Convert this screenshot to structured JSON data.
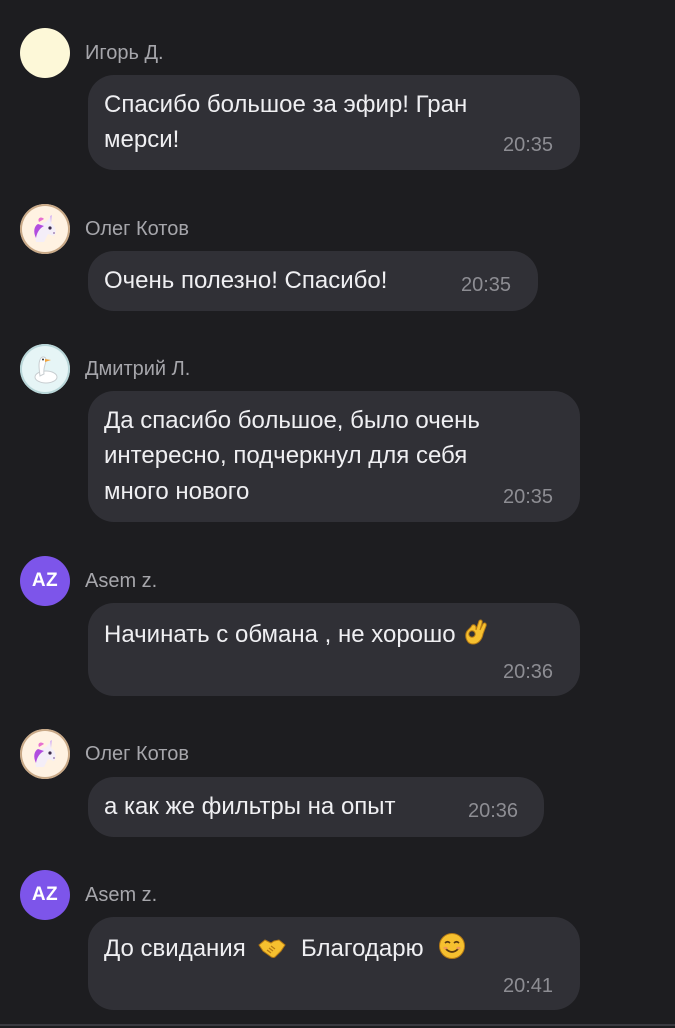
{
  "messages": [
    {
      "author": "Игорь Д.",
      "avatar": "blank-yellow-avatar",
      "lines": [
        "Спасибо большое за эфир! Гран",
        "мерси!"
      ],
      "time": "20:35"
    },
    {
      "author": "Олег Котов",
      "avatar": "unicorn-icon",
      "lines": [
        "Очень полезно! Спасибо!"
      ],
      "time": "20:35"
    },
    {
      "author": "Дмитрий Л.",
      "avatar": "goose-icon",
      "lines": [
        "Да спасибо большое, было очень",
        "интересно, подчеркнул для себя",
        "много нового"
      ],
      "time": "20:35"
    },
    {
      "author": "Asem z.",
      "avatar_initials": "AZ",
      "lines": [
        "Начинать с обмана , не хорошо"
      ],
      "emoji": "ok-hand-emoji",
      "time": "20:36"
    },
    {
      "author": "Олег Котов",
      "avatar": "unicorn-icon",
      "lines": [
        "а как же фильтры на опыт"
      ],
      "time": "20:36"
    },
    {
      "author": "Asem z.",
      "avatar_initials": "AZ",
      "lines": [
        "До свидания",
        "Благодарю"
      ],
      "emojis": [
        "handshake-emoji",
        "smiling-face-emoji"
      ],
      "time": "20:41"
    }
  ],
  "colors": {
    "background": "#1d1d20",
    "bubble": "#303036",
    "author": "#a6a6ab",
    "text": "#efeff2",
    "time": "#8d8d93",
    "initials_avatar": "#7d55ea"
  }
}
